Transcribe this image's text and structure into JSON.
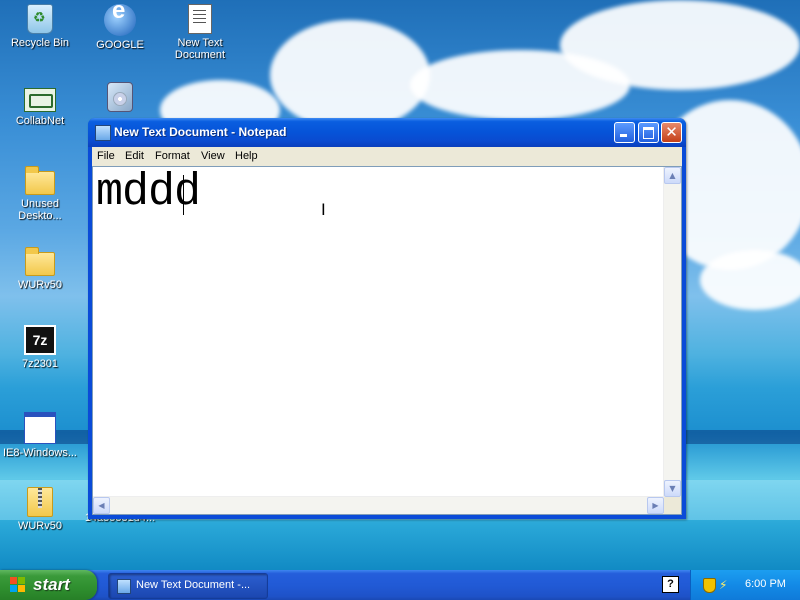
{
  "desktop": {
    "icons": [
      {
        "label": "Recycle Bin"
      },
      {
        "label": "GOOGLE"
      },
      {
        "label": "New Text Document"
      },
      {
        "label": "CollabNet"
      },
      {
        "label": ""
      },
      {
        "label": "Unused Deskto..."
      },
      {
        "label": "WURv50"
      },
      {
        "label": "7z2301"
      },
      {
        "label": "IE8-Windows..."
      },
      {
        "label": "WURv50"
      },
      {
        "label": "14a35331d4..."
      }
    ]
  },
  "window": {
    "title": "New Text Document - Notepad",
    "menu": [
      "File",
      "Edit",
      "Format",
      "View",
      "Help"
    ],
    "content": "mddd"
  },
  "taskbar": {
    "start_label": "start",
    "task_label": "New Text Document -...",
    "help_glyph": "?",
    "clock": "6:00 PM"
  },
  "colors": {
    "titlebar": "#0653d8",
    "taskbar": "#245edb",
    "start": "#3a9a3a"
  }
}
